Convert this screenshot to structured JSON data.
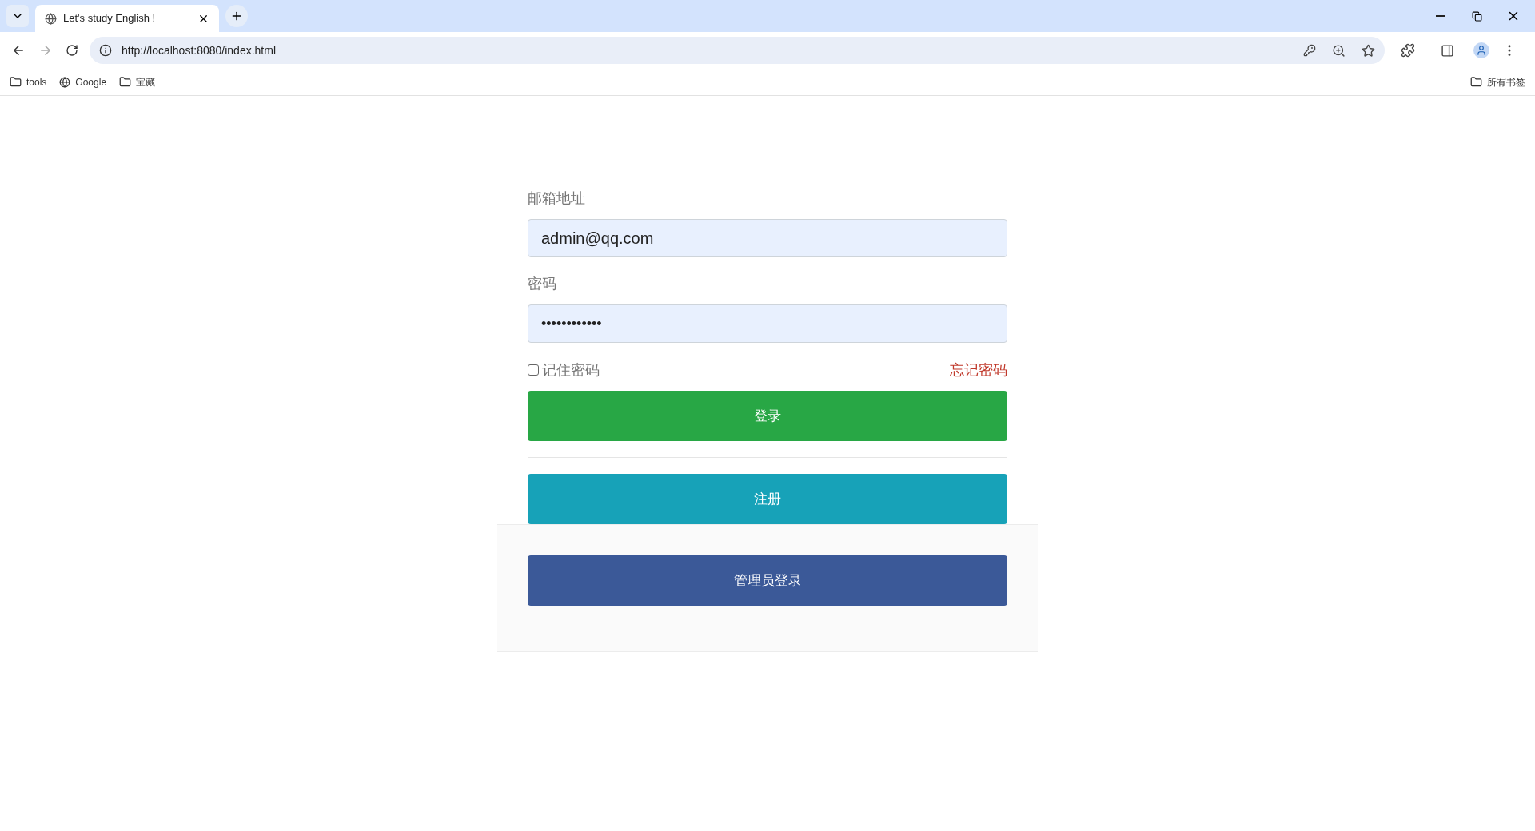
{
  "browser": {
    "tab_title": "Let's study English !",
    "url": "http://localhost:8080/index.html",
    "bookmarks": [
      {
        "label": "tools",
        "kind": "folder"
      },
      {
        "label": "Google",
        "kind": "site"
      },
      {
        "label": "宝藏",
        "kind": "folder"
      }
    ],
    "all_bookmarks": "所有书签"
  },
  "form": {
    "email": {
      "label": "邮箱地址",
      "value": "admin@qq.com"
    },
    "password": {
      "label": "密码",
      "value": "••••••••••••"
    },
    "remember": {
      "label": "记住密码",
      "checked": false
    },
    "forgot_link": "忘记密码",
    "buttons": [
      {
        "label": "登录",
        "kind": "login"
      },
      {
        "label": "注册",
        "kind": "register"
      }
    ],
    "admin_button": "管理员登录"
  }
}
